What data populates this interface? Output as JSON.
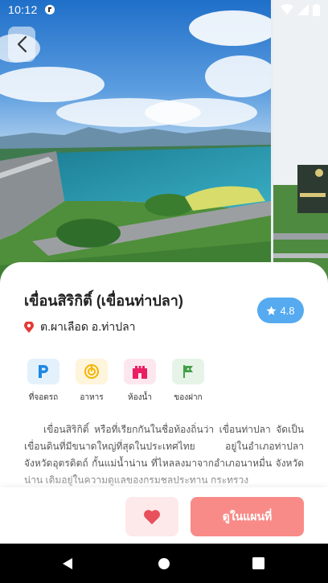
{
  "status_bar": {
    "time": "10:12"
  },
  "place": {
    "title": "เขื่อนสิริกิติ์ (เขื่อนท่าปลา)",
    "location": "ต.ผาเลือด อ.ท่าปลา",
    "rating": "4.8"
  },
  "facilities": [
    {
      "icon": "parking-icon",
      "label": "ที่จอดรถ",
      "color": "#1e88e5",
      "bg": "#e3f1fc"
    },
    {
      "icon": "food-icon",
      "label": "อาหาร",
      "color": "#f5b400",
      "bg": "#fff5dc"
    },
    {
      "icon": "restroom-icon",
      "label": "ห้องน้ำ",
      "color": "#e91e63",
      "bg": "#fde7ee"
    },
    {
      "icon": "souvenir-icon",
      "label": "ของฝาก",
      "color": "#43a047",
      "bg": "#e6f4e7"
    }
  ],
  "description": "เขื่อนสิริกิติ์ หรือที่เรียกกันในชื่อท้องถิ่นว่า เขื่อนท่าปลา จัดเป็นเขื่อนดินที่มีขนาดใหญ่ที่สุดในประเทศไทย อยู่ในอำเภอท่าปลา จังหวัดอุตรดิตถ์ กั้นแม่น้ำน่าน ที่ไหลลงมาจากอำเภอนาหมื่น จังหวัดน่าน เดิมอยู่ในความดูแลของกรมชลประทาน กระทรวง",
  "actions": {
    "map_label": "ดูในแผนที่"
  },
  "colors": {
    "accent": "#f88b88",
    "rating_bg": "#55aaf0",
    "fav_bg": "#fde9ea",
    "heart": "#e8505b"
  }
}
